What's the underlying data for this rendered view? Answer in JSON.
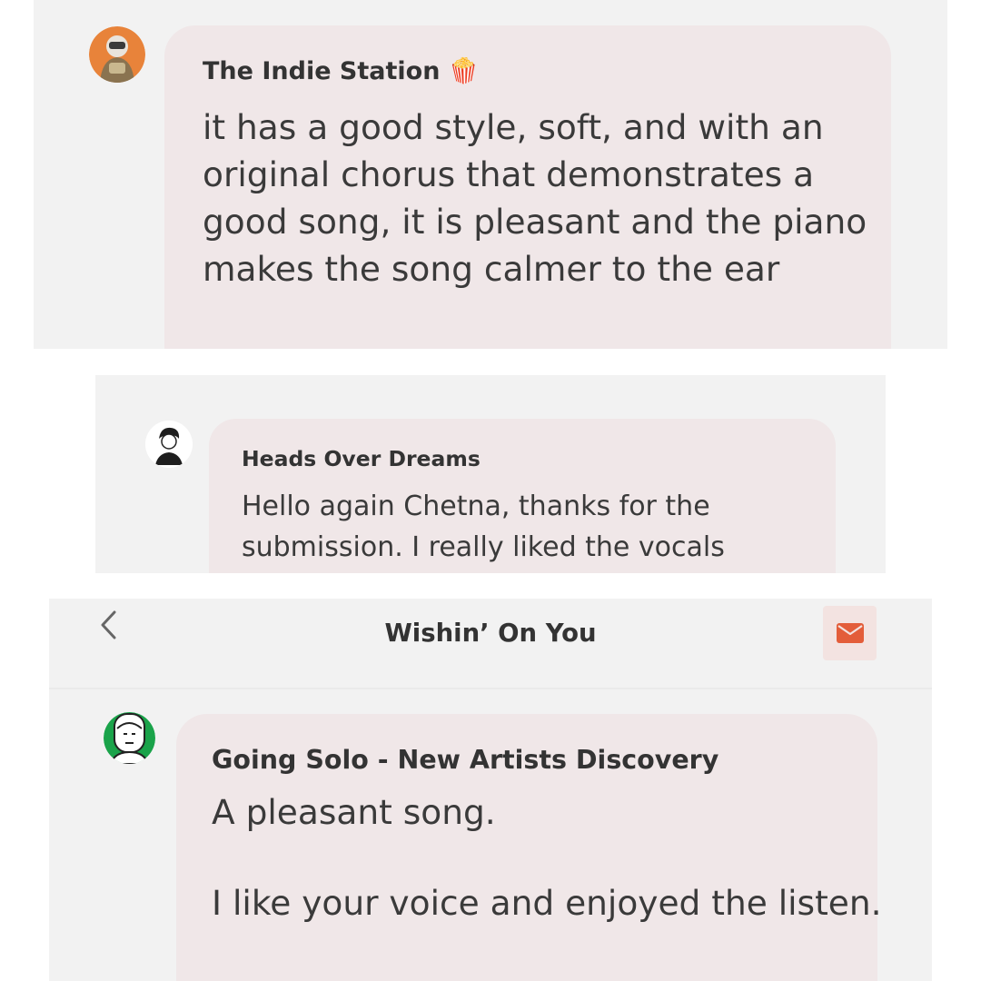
{
  "panel1": {
    "sender": "The Indie Station",
    "sender_emoji": "🍿",
    "avatar_icon": "astronaut-avatar",
    "message": "it has a good style, soft, and with an original chorus that demonstrates a good song, it is pleasant and the piano makes the song calmer to the ear"
  },
  "panel2": {
    "sender": "Heads Over Dreams",
    "avatar_icon": "sketch-person-avatar",
    "message": "Hello again Chetna, thanks for the submission. I really liked the vocals"
  },
  "panel3": {
    "header": {
      "back_icon": "chevron-left-icon",
      "title": "Wishin’ On You",
      "mail_icon": "envelope-icon"
    },
    "sender": "Going Solo - New Artists Discovery",
    "avatar_icon": "line-face-avatar",
    "message": "A pleasant song.\n\nI like your voice and enjoyed the listen."
  },
  "colors": {
    "panel_bg": "#f2f2f2",
    "bubble_bg": "#f0e7e8",
    "accent": "#e35d3a",
    "mail_button_bg": "#f3e3e1",
    "avatar_green": "#1aa34a"
  }
}
